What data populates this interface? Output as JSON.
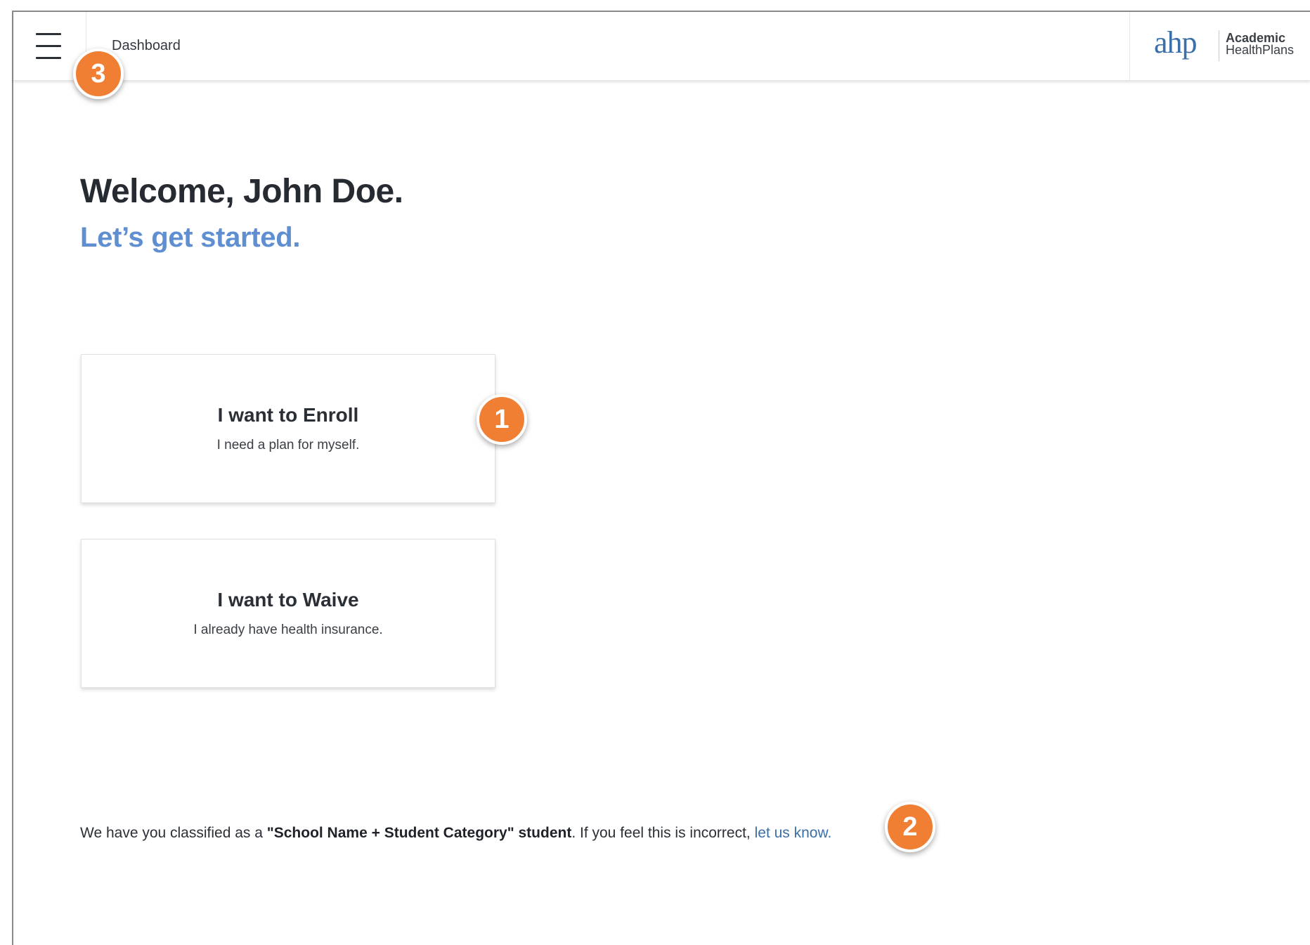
{
  "header": {
    "breadcrumb": "Dashboard",
    "logo": {
      "mark": "ahp",
      "line1": "Academic",
      "line2": "HealthPlans"
    }
  },
  "main": {
    "welcome": "Welcome, John Doe.",
    "subtitle": "Let’s get started.",
    "cards": [
      {
        "title": "I want to Enroll",
        "description": "I need a plan for myself."
      },
      {
        "title": "I want to Waive",
        "description": "I already have health insurance."
      }
    ],
    "classification": {
      "prefix": "We have you classified as a ",
      "bold": "\"School Name + Student Category\" student",
      "middle": ". If you feel this is incorrect, ",
      "link": "let us know."
    }
  },
  "annotations": {
    "badge1": "1",
    "badge2": "2",
    "badge3": "3"
  },
  "colors": {
    "accent": "#5f8fd0",
    "link": "#3b6fa8",
    "badge": "#f07f34"
  },
  "icons": {
    "menu": "hamburger-menu-icon"
  }
}
